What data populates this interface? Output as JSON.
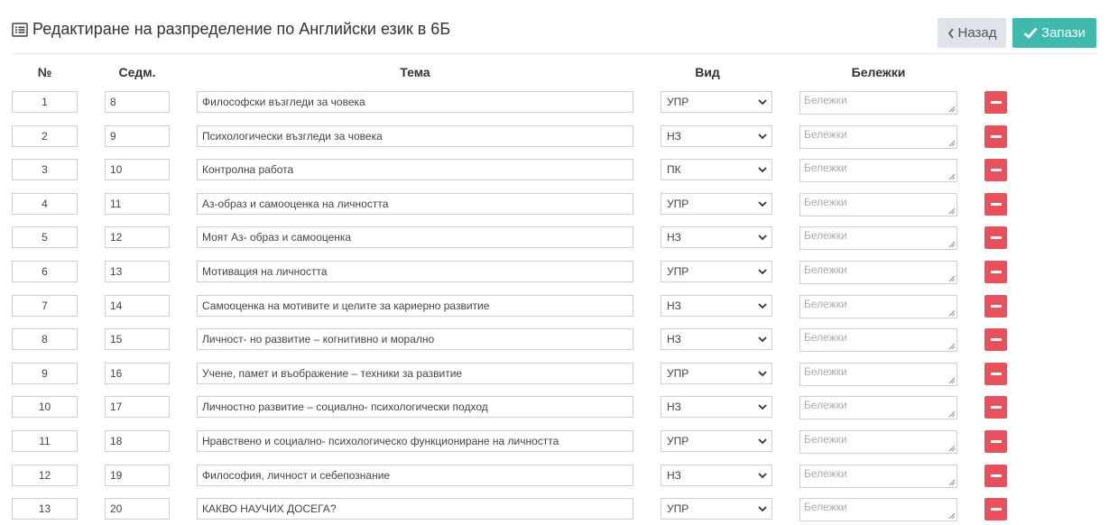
{
  "header": {
    "title": "Редактиране на разпределение по Английски език в 6Б",
    "title_icon": "list-alt-icon",
    "back_label": "Назад",
    "save_label": "Запази"
  },
  "colors": {
    "accent": "#3fb9ac",
    "danger": "#e8505b",
    "back_bg": "#dfe4ea"
  },
  "columns": {
    "num": "№",
    "week": "Седм.",
    "topic": "Тема",
    "kind": "Вид",
    "notes": "Бележки"
  },
  "notes_placeholder": "Бележки",
  "rows": [
    {
      "num": "1",
      "week": "8",
      "topic": "Философски възгледи за човека",
      "kind": "УПР"
    },
    {
      "num": "2",
      "week": "9",
      "topic": "Психологически възгледи за човека",
      "kind": "НЗ"
    },
    {
      "num": "3",
      "week": "10",
      "topic": "Контролна работа",
      "kind": "ПК"
    },
    {
      "num": "4",
      "week": "11",
      "topic": "Аз-образ и самооценка на личността",
      "kind": "УПР"
    },
    {
      "num": "5",
      "week": "12",
      "topic": "Моят Аз- образ и самооценка",
      "kind": "НЗ"
    },
    {
      "num": "6",
      "week": "13",
      "topic": "Мотивация на личността",
      "kind": "УПР"
    },
    {
      "num": "7",
      "week": "14",
      "topic": "Самооценка на мотивите и целите за кариерно развитие",
      "kind": "НЗ"
    },
    {
      "num": "8",
      "week": "15",
      "topic": "Личност- но развитие – когнитивно и морално",
      "kind": "НЗ"
    },
    {
      "num": "9",
      "week": "16",
      "topic": "Учене, памет и въображение – техники за развитие",
      "kind": "УПР"
    },
    {
      "num": "10",
      "week": "17",
      "topic": "Личностно развитие – социално- психологически подход",
      "kind": "НЗ"
    },
    {
      "num": "11",
      "week": "18",
      "topic": "Нравствено и социално- психологическо функциониране на личността",
      "kind": "УПР"
    },
    {
      "num": "12",
      "week": "19",
      "topic": "Философия, личност и себепознание",
      "kind": "НЗ"
    },
    {
      "num": "13",
      "week": "20",
      "topic": "КАКВО НАУЧИХ ДОСЕГА?",
      "kind": "УПР"
    }
  ]
}
